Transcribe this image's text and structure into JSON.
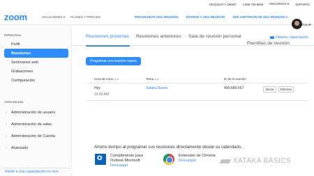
{
  "topbar": {
    "request_demo": "REQUEST A DEMO",
    "phone": "1.888.799.9666",
    "resources": "RECURSOS",
    "support": "SOPORTE"
  },
  "header": {
    "logo": "zoom",
    "nav": [
      "SOLUCIONES",
      "PLANES Y PRECIOS"
    ],
    "schedule": "PROGRAMAR UNA REUNIÓN",
    "join": "ENTRAR A UNA REUNIÓN",
    "host": "SER ANFITRIÓN DE UNA REUNIÓN",
    "logout": "SALIR"
  },
  "sidebar": {
    "personal_heading": "PERSONAL",
    "items": [
      "Perfil",
      "Reuniones",
      "Seminarios web",
      "Grabaciones",
      "Configuración"
    ],
    "active_index": 1,
    "admin_heading": "Administrador",
    "admin_items": [
      "Administración de usuario",
      "Administración de salas",
      "Administración de Cuenta",
      "Avanzado"
    ],
    "footer_link": "Asistir a una capacitación en vivo"
  },
  "main": {
    "tabs": [
      "Reuniones próximas",
      "Reuniones anteriores",
      "Sala de reunión personal",
      "Plantillas de reunión"
    ],
    "active_tab": 0,
    "training_link": "Obtener capacitación",
    "schedule_button": "Programar una reunión nueva",
    "table": {
      "headers": [
        "Hora de inicio",
        "Tema",
        "ID de la reunión"
      ],
      "rows": [
        {
          "date": "Hoy",
          "time": "10:00 AM",
          "topic": "Xataka Basics",
          "id": "400-689-557",
          "start": "Iniciar",
          "delete": "Eliminar"
        }
      ]
    },
    "promo": {
      "title": "Ahorre tiempo al programar sus reuniones directamente desde su calendario.",
      "apps": [
        {
          "name_line1": "Complemento para",
          "name_line2": "Outlook Microsoft",
          "link": "Descargar"
        },
        {
          "name_line1": "Extensión de Chrome",
          "link": "Descargar"
        }
      ]
    }
  },
  "watermark": "XATAKA BASICS",
  "colors": {
    "accent": "#2d8cff"
  }
}
